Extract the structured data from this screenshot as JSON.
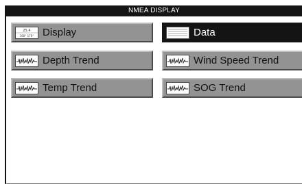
{
  "title": "NMEA DISPLAY",
  "menu": [
    {
      "id": "display",
      "label": "Display",
      "icon": "numeric-display-icon",
      "values": [
        "25.4",
        "160°  170°"
      ],
      "selected": false
    },
    {
      "id": "data",
      "label": "Data",
      "icon": "data-list-icon",
      "selected": true
    },
    {
      "id": "depth-trend",
      "label": "Depth Trend",
      "icon": "trend-graph-icon",
      "selected": false
    },
    {
      "id": "wind-speed-trend",
      "label": "Wind Speed Trend",
      "icon": "trend-graph-icon",
      "selected": false
    },
    {
      "id": "temp-trend",
      "label": "Temp Trend",
      "icon": "trend-graph-icon",
      "selected": false
    },
    {
      "id": "sog-trend",
      "label": "SOG Trend",
      "icon": "trend-graph-icon",
      "selected": false
    }
  ],
  "colors": {
    "button": "#939393",
    "selected": "#141414",
    "titlebar": "#151515"
  }
}
